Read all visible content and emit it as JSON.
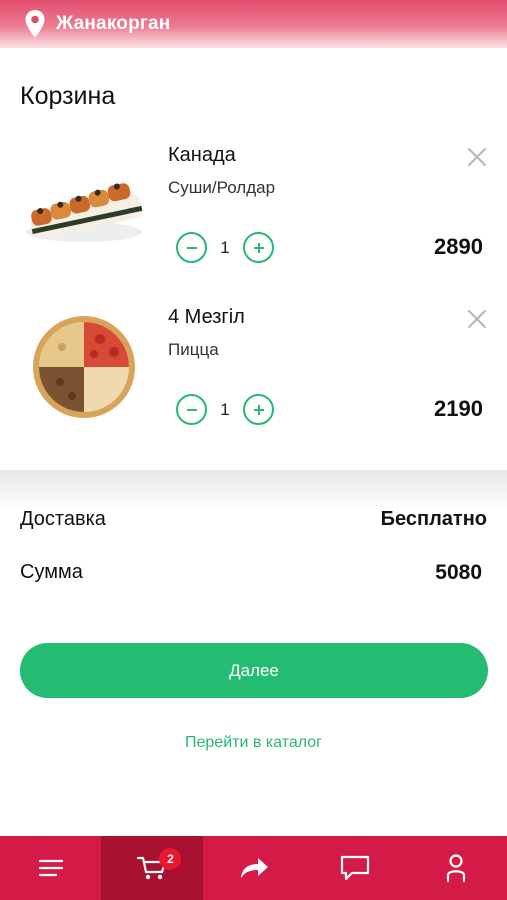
{
  "header": {
    "city": "Жанакорган"
  },
  "cart": {
    "title": "Корзина",
    "items": [
      {
        "name": "Канада",
        "category": "Суши/Ролдар",
        "quantity": "1",
        "price": "2890"
      },
      {
        "name": "4 Мезгіл",
        "category": "Пицца",
        "quantity": "1",
        "price": "2190"
      }
    ]
  },
  "summary": {
    "delivery_label": "Доставка",
    "delivery_value": "Бесплатно",
    "sum_label": "Сумма",
    "sum_value": "5080"
  },
  "actions": {
    "next_label": "Далее",
    "catalog_link": "Перейти в каталог"
  },
  "navbar": {
    "items": [
      {
        "icon": "menu-icon"
      },
      {
        "icon": "cart-icon",
        "badge": "2",
        "active": true
      },
      {
        "icon": "share-icon"
      },
      {
        "icon": "chat-icon"
      },
      {
        "icon": "profile-icon"
      }
    ]
  },
  "colors": {
    "brand": "#d41b48",
    "accent": "#24bb72"
  }
}
